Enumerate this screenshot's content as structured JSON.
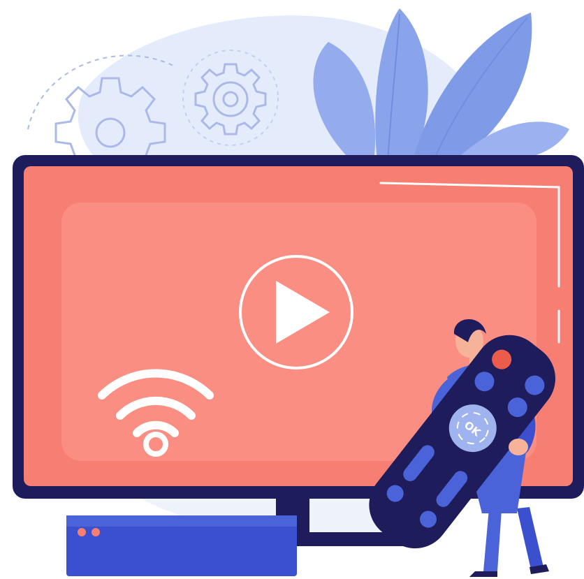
{
  "illustration": {
    "subject": "smart-tv-remote-control",
    "remote": {
      "ok_label": "OK"
    }
  },
  "icons": [
    "gear-icon",
    "gear-icon",
    "play-icon",
    "wifi-icon",
    "power-icon"
  ],
  "colors": {
    "screen": "#f77e72",
    "screen_inner": "#fb8e82",
    "frame": "#1f1c5c",
    "accent_blue": "#4a63d8",
    "leaf": "#8aa4ec",
    "background_blob": "#e4ebfa",
    "gear_stroke": "#aab9e8",
    "power_red": "#ec5c4b"
  }
}
